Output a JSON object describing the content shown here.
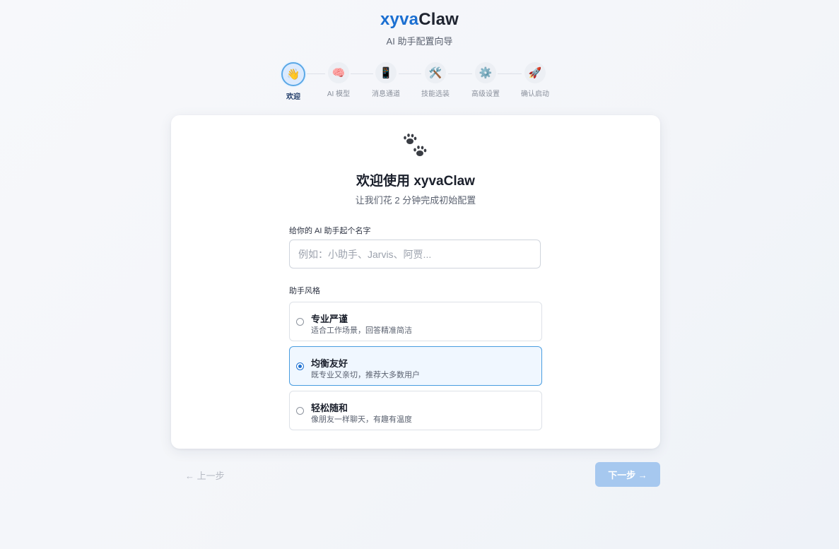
{
  "header": {
    "brand_part1": "xyva",
    "brand_part2": "Claw",
    "subtitle": "AI 助手配置向导"
  },
  "steps": [
    {
      "icon": "👋",
      "icon_name": "waving-hand-icon",
      "label": "欢迎",
      "active": true
    },
    {
      "icon": "🧠",
      "icon_name": "brain-icon",
      "label": "AI 模型",
      "active": false
    },
    {
      "icon": "📱",
      "icon_name": "mobile-phone-icon",
      "label": "消息通道",
      "active": false
    },
    {
      "icon": "🛠️",
      "icon_name": "tools-icon",
      "label": "技能选装",
      "active": false
    },
    {
      "icon": "⚙️",
      "icon_name": "gear-icon",
      "label": "高级设置",
      "active": false
    },
    {
      "icon": "🚀",
      "icon_name": "rocket-icon",
      "label": "确认启动",
      "active": false
    }
  ],
  "card": {
    "icon_name": "paw-prints-icon",
    "title": "欢迎使用 xyvaClaw",
    "subtitle": "让我们花 2 分钟完成初始配置",
    "name_label": "给你的 AI 助手起个名字",
    "name_placeholder": "例如：小助手、Jarvis、阿贾...",
    "name_value": "",
    "style_label": "助手风格",
    "options": [
      {
        "title": "专业严谨",
        "desc": "适合工作场景，回答精准简洁",
        "selected": false
      },
      {
        "title": "均衡友好",
        "desc": "既专业又亲切，推荐大多数用户",
        "selected": true
      },
      {
        "title": "轻松随和",
        "desc": "像朋友一样聊天，有趣有温度",
        "selected": false
      }
    ]
  },
  "nav": {
    "prev_label": "← 上一步",
    "next_label": "下一步 →"
  },
  "colors": {
    "accent": "#1b6fd1",
    "next_button_disabled": "#a6c8ef",
    "selected_option_bg": "#f0f7ff"
  }
}
